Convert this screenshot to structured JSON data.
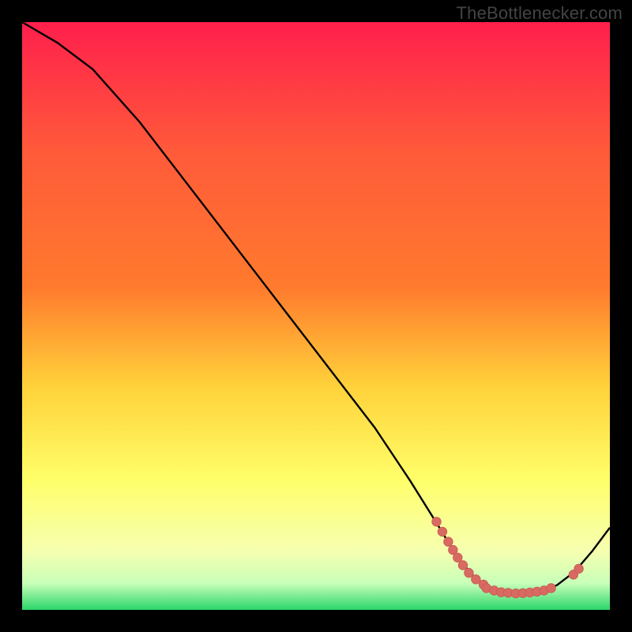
{
  "watermark": "TheBottlenecker.com",
  "colors": {
    "bg_black": "#000000",
    "grad_top": "#ff1f4c",
    "grad_mid1": "#ff7a2d",
    "grad_mid2": "#ffd23a",
    "grad_mid3": "#ffff6a",
    "grad_mid4": "#f6ffb0",
    "grad_bottom": "#2bd66a",
    "line": "#000000",
    "dot_fill": "#d86a62",
    "dot_stroke": "#c55a52"
  },
  "chart_data": {
    "type": "line",
    "title": "",
    "xlabel": "",
    "ylabel": "",
    "xlim": [
      0,
      100
    ],
    "ylim": [
      0,
      100
    ],
    "curve": [
      {
        "x": 0,
        "y": 100
      },
      {
        "x": 6,
        "y": 96.5
      },
      {
        "x": 12,
        "y": 92
      },
      {
        "x": 20,
        "y": 83
      },
      {
        "x": 30,
        "y": 70
      },
      {
        "x": 40,
        "y": 57
      },
      {
        "x": 50,
        "y": 44
      },
      {
        "x": 60,
        "y": 31
      },
      {
        "x": 66,
        "y": 22
      },
      {
        "x": 71,
        "y": 14
      },
      {
        "x": 74,
        "y": 9
      },
      {
        "x": 77,
        "y": 5.5
      },
      {
        "x": 80,
        "y": 3.5
      },
      {
        "x": 84,
        "y": 2.8
      },
      {
        "x": 88,
        "y": 3.0
      },
      {
        "x": 91,
        "y": 4.2
      },
      {
        "x": 94,
        "y": 6.5
      },
      {
        "x": 97,
        "y": 10
      },
      {
        "x": 100,
        "y": 14
      }
    ],
    "dots": [
      {
        "x": 70.5,
        "y": 15.0
      },
      {
        "x": 71.5,
        "y": 13.3
      },
      {
        "x": 72.5,
        "y": 11.6
      },
      {
        "x": 73.3,
        "y": 10.2
      },
      {
        "x": 74.1,
        "y": 8.9
      },
      {
        "x": 75.0,
        "y": 7.6
      },
      {
        "x": 76.0,
        "y": 6.3
      },
      {
        "x": 77.2,
        "y": 5.2
      },
      {
        "x": 78.5,
        "y": 4.3
      },
      {
        "x": 79.0,
        "y": 3.7
      },
      {
        "x": 80.3,
        "y": 3.3
      },
      {
        "x": 81.5,
        "y": 3.0
      },
      {
        "x": 82.7,
        "y": 2.9
      },
      {
        "x": 84.0,
        "y": 2.8
      },
      {
        "x": 85.2,
        "y": 2.85
      },
      {
        "x": 86.4,
        "y": 2.95
      },
      {
        "x": 87.6,
        "y": 3.1
      },
      {
        "x": 88.8,
        "y": 3.3
      },
      {
        "x": 90.0,
        "y": 3.7
      },
      {
        "x": 93.8,
        "y": 6.0
      },
      {
        "x": 94.7,
        "y": 7.0
      }
    ],
    "gradient_bands": [
      {
        "y0": 0,
        "y1": 80,
        "c0": "grad_top",
        "c1": "grad_mid3"
      },
      {
        "y0": 80,
        "y1": 90,
        "c0": "grad_mid3",
        "c1": "grad_mid4"
      },
      {
        "y0": 90,
        "y1": 100,
        "c0": "grad_mid4",
        "c1": "grad_bottom"
      }
    ]
  }
}
